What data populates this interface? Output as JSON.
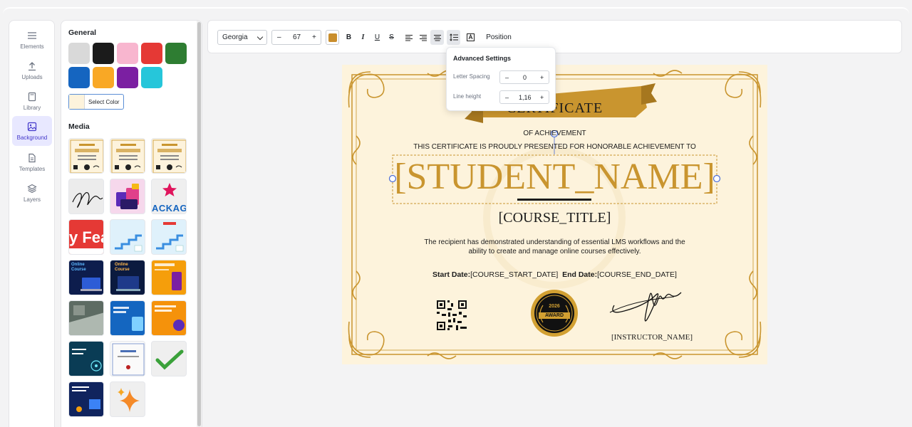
{
  "rail": {
    "items": [
      {
        "label": "Elements",
        "icon": "menu-icon"
      },
      {
        "label": "Uploads",
        "icon": "upload-icon"
      },
      {
        "label": "Library",
        "icon": "book-icon"
      },
      {
        "label": "Background",
        "icon": "image-icon"
      },
      {
        "label": "Templates",
        "icon": "document-icon"
      },
      {
        "label": "Layers",
        "icon": "layers-icon"
      }
    ],
    "active": "Background"
  },
  "panel": {
    "general_title": "General",
    "swatches": [
      "#d9d9d9",
      "#1b1b1b",
      "#f8b6cf",
      "#e53935",
      "#2e7d32",
      "#1565c0",
      "#f9a825",
      "#7b1fa2",
      "#26c6da"
    ],
    "select_color_label": "Select Color",
    "media_title": "Media",
    "media_text": {
      "package": "ACKAGE",
      "feature": "y Fea",
      "online_course": "Online Course",
      "badge_2026": "2026"
    }
  },
  "toolbar": {
    "font": "Georgia",
    "font_size": "67",
    "minus": "–",
    "plus": "+",
    "text_color": "#c98e2d",
    "bold": "B",
    "italic": "I",
    "underline": "U",
    "strike": "S",
    "position_label": "Position"
  },
  "advanced": {
    "title": "Advanced Settings",
    "letter_spacing_label": "Letter Spacing",
    "letter_spacing_value": "0",
    "line_height_label": "Line height",
    "line_height_value": "1,16"
  },
  "certificate": {
    "title": "CERTIFICATE",
    "subtitle": "OF ACHIEVEMENT",
    "presented": "THIS CERTIFICATE IS PROUDLY PRESENTED FOR HONORABLE ACHIEVEMENT TO",
    "student": "[STUDENT_NAME]",
    "course": "[COURSE_TITLE]",
    "description_line1": "The recipient has demonstrated understanding of essential LMS workflows and the",
    "description_line2": "ability to create and manage online courses effectively.",
    "start_label": "Start Date:",
    "start_value": "[COURSE_START_DATE]",
    "end_label": "End Date:",
    "end_value": "[COURSE_END_DATE]",
    "award_year": "2026",
    "award_text": "AWARD",
    "instructor": "[INSTRUCTOR_NAME]",
    "accent": "#c9952f"
  }
}
